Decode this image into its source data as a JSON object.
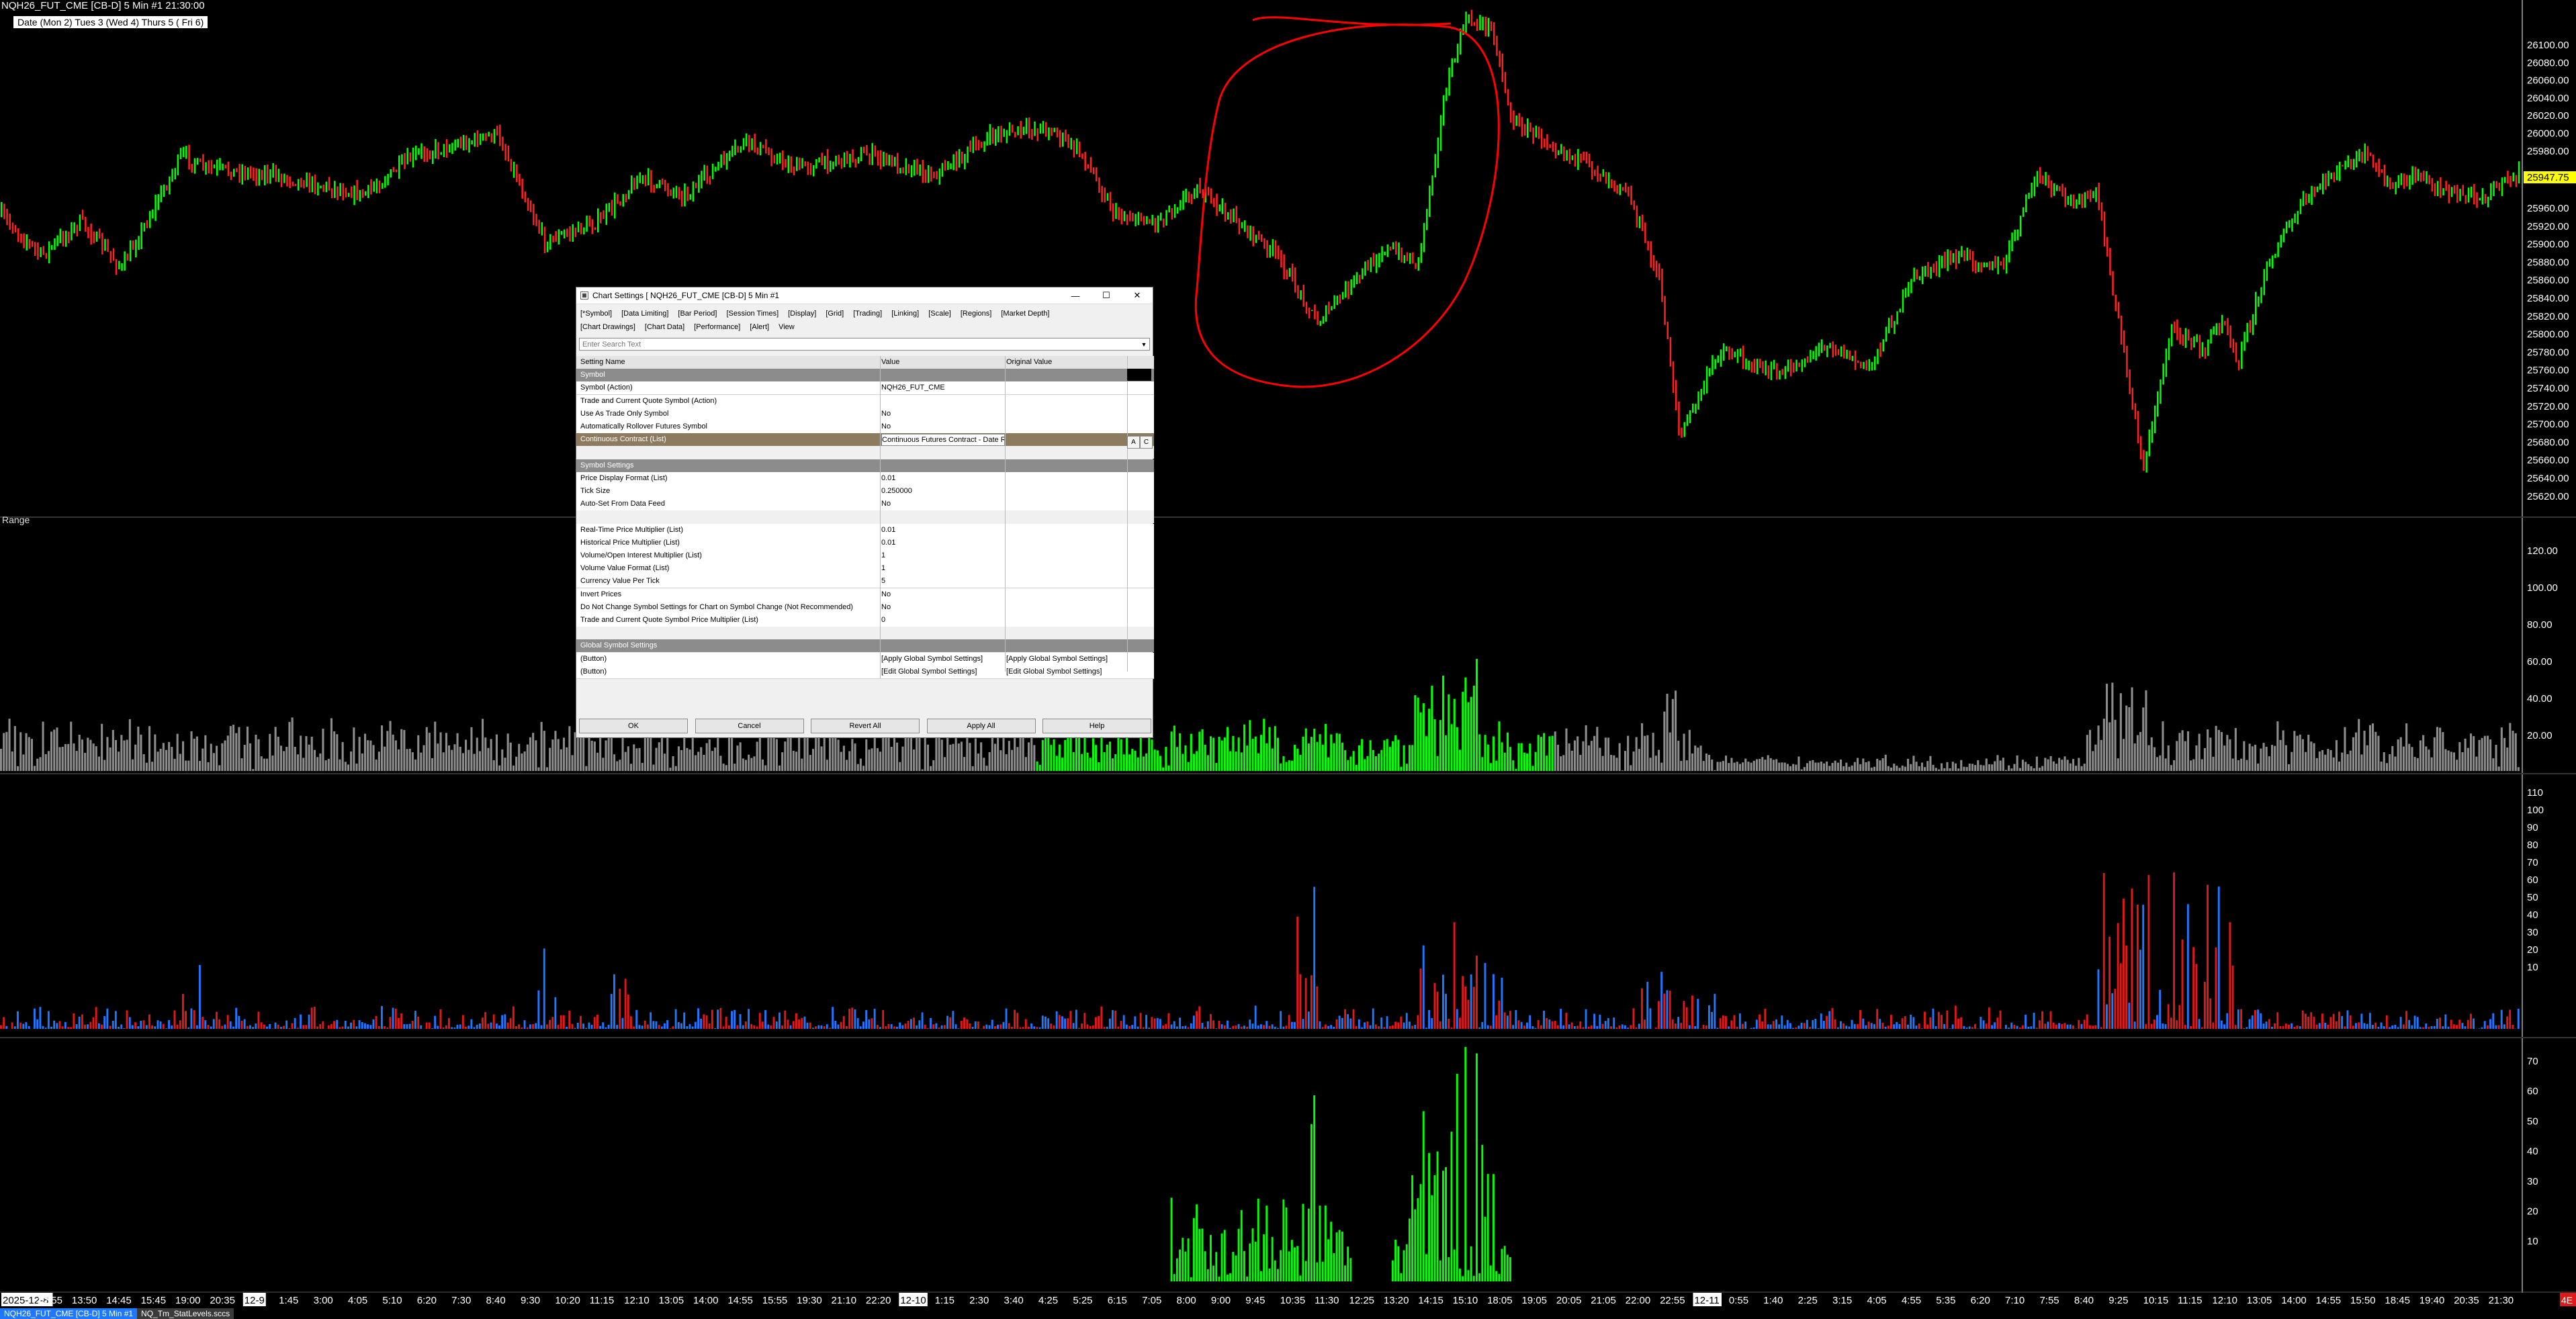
{
  "chart_header": {
    "title": "NQH26_FUT_CME [CB-D]  5 Min  #1 21:30:00",
    "date_row": "Date (Mon 2)   Tues 3   (Wed 4)   Thurs 5   ( Fri 6)"
  },
  "price_axis": {
    "labels": [
      "26100.00",
      "26080.00",
      "26060.00",
      "26040.00",
      "26020.00",
      "26000.00",
      "25980.00",
      "25960.00",
      "25920.00",
      "25900.00",
      "25880.00",
      "25860.00",
      "25840.00",
      "25820.00",
      "25800.00",
      "25780.00",
      "25760.00",
      "25740.00",
      "25720.00",
      "25700.00",
      "25680.00",
      "25660.00",
      "25640.00",
      "25620.00"
    ],
    "current_price": "25947.75",
    "current_color": "#ffff00"
  },
  "range_study": {
    "label": "Range",
    "axis": [
      "120.00",
      "100.00",
      "80.00",
      "60.00",
      "40.00",
      "20.00"
    ]
  },
  "volume_axis": [
    "110",
    "100",
    "90",
    "80",
    "70",
    "60",
    "50",
    "40",
    "30",
    "20",
    "10"
  ],
  "bottom_axis": [
    "70",
    "60",
    "50",
    "40",
    "30",
    "20",
    "10"
  ],
  "time_axis": [
    "2025-12-8",
    "12:55",
    "13:50",
    "14:45",
    "15:45",
    "19:00",
    "20:35",
    "12-9",
    "1:45",
    "3:00",
    "4:05",
    "5:10",
    "6:20",
    "7:30",
    "8:40",
    "9:30",
    "10:20",
    "11:15",
    "12:10",
    "13:05",
    "14:00",
    "14:55",
    "15:55",
    "19:30",
    "21:10",
    "22:20",
    "12-10",
    "1:15",
    "2:30",
    "3:40",
    "4:25",
    "5:25",
    "6:15",
    "7:05",
    "8:00",
    "9:00",
    "9:45",
    "10:35",
    "11:30",
    "12:25",
    "13:20",
    "14:15",
    "15:10",
    "18:05",
    "19:05",
    "20:05",
    "21:05",
    "22:00",
    "22:55",
    "12-11",
    "0:55",
    "1:40",
    "2:25",
    "3:15",
    "4:05",
    "4:55",
    "5:35",
    "6:20",
    "7:10",
    "7:55",
    "8:40",
    "9:25",
    "10:15",
    "11:15",
    "12:10",
    "13:05",
    "14:00",
    "14:55",
    "15:50",
    "18:45",
    "19:40",
    "20:35",
    "21:30"
  ],
  "colors": {
    "up_bar": "#00ff00",
    "down_bar": "#ff2020",
    "grey_bar": "#8c8c8c",
    "blue_bar": "#1e78ff",
    "red_bar": "#e01818",
    "green_bar": "#00ff00",
    "annotation": "#ff0000"
  },
  "dialog": {
    "title": "Chart Settings [ NQH26_FUT_CME [CB-D]  5 Min  #1",
    "tabs_row1": [
      "[*Symbol]",
      "[Data Limiting]",
      "[Bar Period]",
      "[Session Times]",
      "[Display]",
      "[Grid]",
      "[Trading]",
      "[Linking]",
      "[Scale]",
      "[Regions]",
      "[Market Depth]"
    ],
    "tabs_row2": [
      "[Chart Drawings]",
      "[Chart Data]",
      "[Performance]",
      "[Alert]",
      "View"
    ],
    "search_placeholder": "Enter Search Text",
    "columns": [
      "Setting Name",
      "Value",
      "Original Value"
    ],
    "rows": [
      {
        "kind": "sec",
        "name": "Symbol",
        "value": "",
        "orig": ""
      },
      {
        "kind": "item",
        "name": "Symbol (Action)",
        "value": "NQH26_FUT_CME",
        "orig": ""
      },
      {
        "kind": "item",
        "name": "Trade and Current Quote Symbol (Action)",
        "value": "",
        "orig": ""
      },
      {
        "kind": "item",
        "name": "Use As Trade Only Symbol",
        "value": "No",
        "orig": ""
      },
      {
        "kind": "item",
        "name": "Automatically Rollover Futures Symbol",
        "value": "No",
        "orig": ""
      },
      {
        "kind": "sel",
        "name": "Continuous Contract (List)",
        "value": "Continuous Futures Contract - Date Rule Rollover, Back Adjusted",
        "orig": ""
      },
      {
        "kind": "blank",
        "name": "",
        "value": "",
        "orig": ""
      },
      {
        "kind": "sec",
        "name": "Symbol Settings",
        "value": "",
        "orig": ""
      },
      {
        "kind": "item",
        "name": "Price Display Format (List)",
        "value": "0.01",
        "orig": ""
      },
      {
        "kind": "item",
        "name": "Tick Size",
        "value": "0.250000",
        "orig": ""
      },
      {
        "kind": "item",
        "name": "Auto-Set From Data Feed",
        "value": "No",
        "orig": ""
      },
      {
        "kind": "blank",
        "name": "",
        "value": "",
        "orig": ""
      },
      {
        "kind": "item",
        "name": "Real-Time Price Multiplier (List)",
        "value": "0.01",
        "orig": ""
      },
      {
        "kind": "item",
        "name": "Historical Price Multiplier (List)",
        "value": "0.01",
        "orig": ""
      },
      {
        "kind": "item",
        "name": "Volume/Open Interest Multiplier (List)",
        "value": "1",
        "orig": ""
      },
      {
        "kind": "item",
        "name": "Volume Value Format (List)",
        "value": "1",
        "orig": ""
      },
      {
        "kind": "item",
        "name": "Currency Value Per Tick",
        "value": "5",
        "orig": ""
      },
      {
        "kind": "item",
        "name": "Invert Prices",
        "value": "No",
        "orig": ""
      },
      {
        "kind": "item",
        "name": "Do Not Change Symbol Settings for Chart on Symbol Change (Not Recommended)",
        "value": "No",
        "orig": ""
      },
      {
        "kind": "item",
        "name": "Trade and Current Quote Symbol Price Multiplier (List)",
        "value": "0",
        "orig": ""
      },
      {
        "kind": "blank",
        "name": "",
        "value": "",
        "orig": ""
      },
      {
        "kind": "sec",
        "name": "Global Symbol Settings",
        "value": "",
        "orig": ""
      },
      {
        "kind": "item",
        "name": "(Button)",
        "value": "[Apply Global Symbol Settings]",
        "orig": "[Apply Global Symbol Settings]"
      },
      {
        "kind": "item",
        "name": "(Button)",
        "value": "[Edit Global Symbol Settings]",
        "orig": "[Edit Global Symbol Settings]"
      }
    ],
    "buttons": [
      "OK",
      "Cancel",
      "Revert All",
      "Apply All",
      "Help"
    ],
    "window_buttons": {
      "min": "—",
      "max": "☐",
      "close": "✕"
    }
  },
  "chartbook_tabs": [
    {
      "label": "NQH26_FUT_CME [CB-D]  5 Min  #1",
      "active": true
    },
    {
      "label": "NQ_Tm_StatLevels.sccs",
      "active": false
    }
  ],
  "corner_badge": "4E"
}
